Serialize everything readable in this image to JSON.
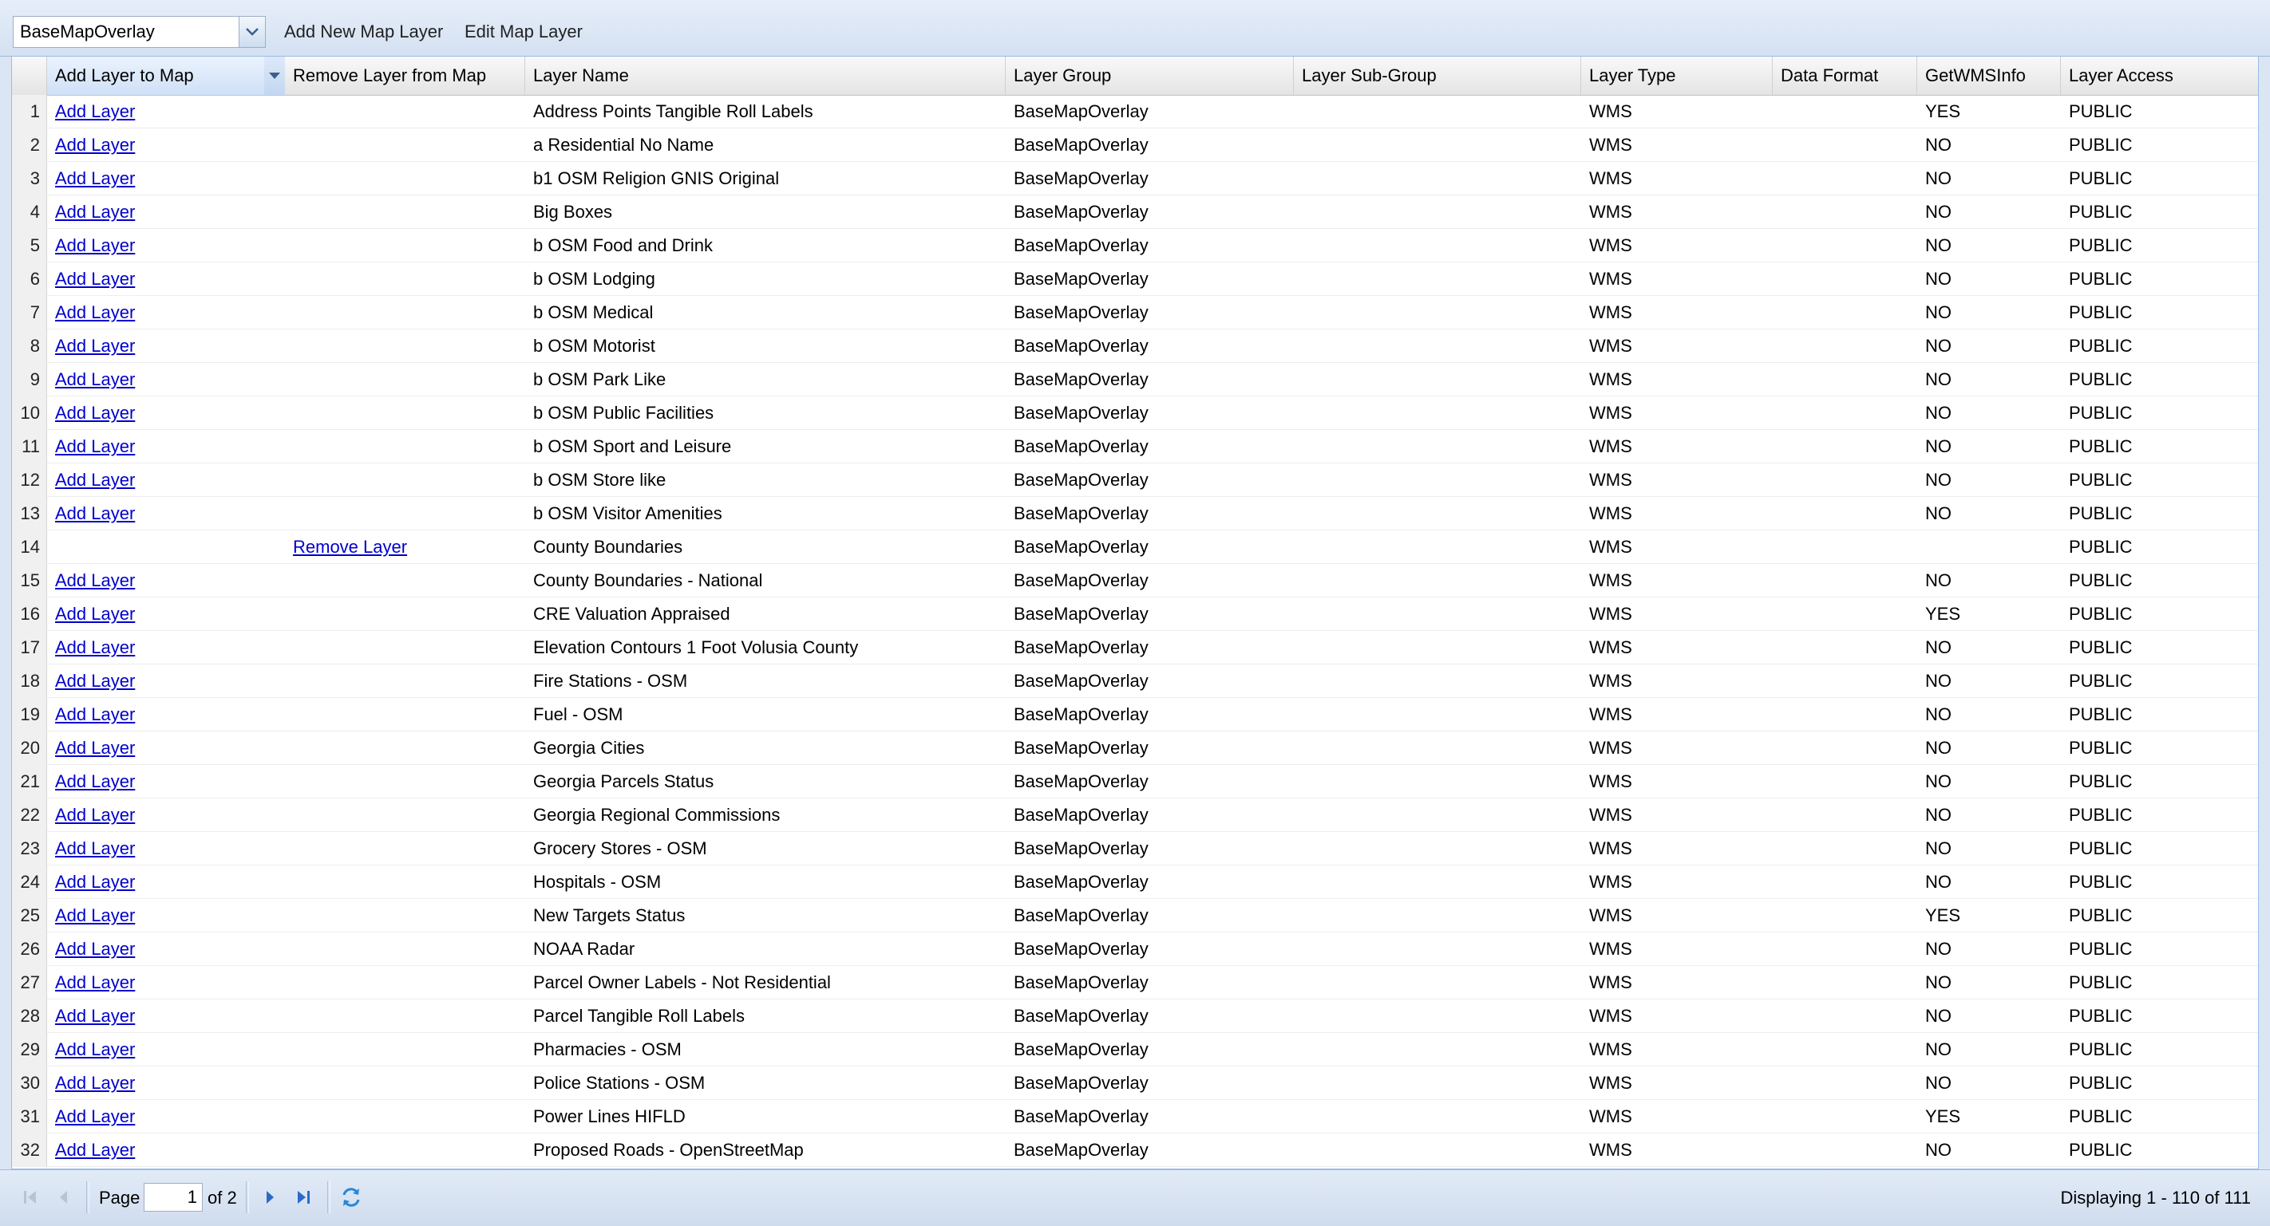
{
  "toolbar": {
    "group_select_value": "BaseMapOverlay",
    "add_new_label": "Add New Map Layer",
    "edit_label": "Edit Map Layer"
  },
  "columns": {
    "add": "Add Layer to Map",
    "remove": "Remove Layer from Map",
    "name": "Layer Name",
    "group": "Layer Group",
    "subgroup": "Layer Sub-Group",
    "type": "Layer Type",
    "format": "Data Format",
    "wms": "GetWMSInfo",
    "access": "Layer Access"
  },
  "rows": [
    {
      "n": "1",
      "add": "Add Layer",
      "remove": "",
      "name": "Address Points Tangible Roll Labels",
      "group": "BaseMapOverlay",
      "subgroup": "",
      "type": "WMS",
      "format": "",
      "wms": "YES",
      "access": "PUBLIC"
    },
    {
      "n": "2",
      "add": "Add Layer",
      "remove": "",
      "name": "a Residential No Name",
      "group": "BaseMapOverlay",
      "subgroup": "",
      "type": "WMS",
      "format": "",
      "wms": "NO",
      "access": "PUBLIC"
    },
    {
      "n": "3",
      "add": "Add Layer",
      "remove": "",
      "name": "b1 OSM Religion GNIS Original",
      "group": "BaseMapOverlay",
      "subgroup": "",
      "type": "WMS",
      "format": "",
      "wms": "NO",
      "access": "PUBLIC"
    },
    {
      "n": "4",
      "add": "Add Layer",
      "remove": "",
      "name": "Big Boxes",
      "group": "BaseMapOverlay",
      "subgroup": "",
      "type": "WMS",
      "format": "",
      "wms": "NO",
      "access": "PUBLIC"
    },
    {
      "n": "5",
      "add": "Add Layer",
      "remove": "",
      "name": "b OSM Food and Drink",
      "group": "BaseMapOverlay",
      "subgroup": "",
      "type": "WMS",
      "format": "",
      "wms": "NO",
      "access": "PUBLIC"
    },
    {
      "n": "6",
      "add": "Add Layer",
      "remove": "",
      "name": "b OSM Lodging",
      "group": "BaseMapOverlay",
      "subgroup": "",
      "type": "WMS",
      "format": "",
      "wms": "NO",
      "access": "PUBLIC"
    },
    {
      "n": "7",
      "add": "Add Layer",
      "remove": "",
      "name": "b OSM Medical",
      "group": "BaseMapOverlay",
      "subgroup": "",
      "type": "WMS",
      "format": "",
      "wms": "NO",
      "access": "PUBLIC"
    },
    {
      "n": "8",
      "add": "Add Layer",
      "remove": "",
      "name": "b OSM Motorist",
      "group": "BaseMapOverlay",
      "subgroup": "",
      "type": "WMS",
      "format": "",
      "wms": "NO",
      "access": "PUBLIC"
    },
    {
      "n": "9",
      "add": "Add Layer",
      "remove": "",
      "name": "b OSM Park Like",
      "group": "BaseMapOverlay",
      "subgroup": "",
      "type": "WMS",
      "format": "",
      "wms": "NO",
      "access": "PUBLIC"
    },
    {
      "n": "10",
      "add": "Add Layer",
      "remove": "",
      "name": "b OSM Public Facilities",
      "group": "BaseMapOverlay",
      "subgroup": "",
      "type": "WMS",
      "format": "",
      "wms": "NO",
      "access": "PUBLIC"
    },
    {
      "n": "11",
      "add": "Add Layer",
      "remove": "",
      "name": "b OSM Sport and Leisure",
      "group": "BaseMapOverlay",
      "subgroup": "",
      "type": "WMS",
      "format": "",
      "wms": "NO",
      "access": "PUBLIC"
    },
    {
      "n": "12",
      "add": "Add Layer",
      "remove": "",
      "name": "b OSM Store like",
      "group": "BaseMapOverlay",
      "subgroup": "",
      "type": "WMS",
      "format": "",
      "wms": "NO",
      "access": "PUBLIC"
    },
    {
      "n": "13",
      "add": "Add Layer",
      "remove": "",
      "name": "b OSM Visitor Amenities",
      "group": "BaseMapOverlay",
      "subgroup": "",
      "type": "WMS",
      "format": "",
      "wms": "NO",
      "access": "PUBLIC"
    },
    {
      "n": "14",
      "add": "",
      "remove": "Remove Layer",
      "name": "County Boundaries",
      "group": "BaseMapOverlay",
      "subgroup": "",
      "type": "WMS",
      "format": "",
      "wms": "",
      "access": "PUBLIC"
    },
    {
      "n": "15",
      "add": "Add Layer",
      "remove": "",
      "name": "County Boundaries - National",
      "group": "BaseMapOverlay",
      "subgroup": "",
      "type": "WMS",
      "format": "",
      "wms": "NO",
      "access": "PUBLIC"
    },
    {
      "n": "16",
      "add": "Add Layer",
      "remove": "",
      "name": "CRE Valuation Appraised",
      "group": "BaseMapOverlay",
      "subgroup": "",
      "type": "WMS",
      "format": "",
      "wms": "YES",
      "access": "PUBLIC"
    },
    {
      "n": "17",
      "add": "Add Layer",
      "remove": "",
      "name": "Elevation Contours 1 Foot Volusia County",
      "group": "BaseMapOverlay",
      "subgroup": "",
      "type": "WMS",
      "format": "",
      "wms": "NO",
      "access": "PUBLIC"
    },
    {
      "n": "18",
      "add": "Add Layer",
      "remove": "",
      "name": "Fire Stations - OSM",
      "group": "BaseMapOverlay",
      "subgroup": "",
      "type": "WMS",
      "format": "",
      "wms": "NO",
      "access": "PUBLIC"
    },
    {
      "n": "19",
      "add": "Add Layer",
      "remove": "",
      "name": "Fuel - OSM",
      "group": "BaseMapOverlay",
      "subgroup": "",
      "type": "WMS",
      "format": "",
      "wms": "NO",
      "access": "PUBLIC"
    },
    {
      "n": "20",
      "add": "Add Layer",
      "remove": "",
      "name": "Georgia Cities",
      "group": "BaseMapOverlay",
      "subgroup": "",
      "type": "WMS",
      "format": "",
      "wms": "NO",
      "access": "PUBLIC"
    },
    {
      "n": "21",
      "add": "Add Layer",
      "remove": "",
      "name": "Georgia Parcels Status",
      "group": "BaseMapOverlay",
      "subgroup": "",
      "type": "WMS",
      "format": "",
      "wms": "NO",
      "access": "PUBLIC"
    },
    {
      "n": "22",
      "add": "Add Layer",
      "remove": "",
      "name": "Georgia Regional Commissions",
      "group": "BaseMapOverlay",
      "subgroup": "",
      "type": "WMS",
      "format": "",
      "wms": "NO",
      "access": "PUBLIC"
    },
    {
      "n": "23",
      "add": "Add Layer",
      "remove": "",
      "name": "Grocery Stores - OSM",
      "group": "BaseMapOverlay",
      "subgroup": "",
      "type": "WMS",
      "format": "",
      "wms": "NO",
      "access": "PUBLIC"
    },
    {
      "n": "24",
      "add": "Add Layer",
      "remove": "",
      "name": "Hospitals - OSM",
      "group": "BaseMapOverlay",
      "subgroup": "",
      "type": "WMS",
      "format": "",
      "wms": "NO",
      "access": "PUBLIC"
    },
    {
      "n": "25",
      "add": "Add Layer",
      "remove": "",
      "name": "New Targets Status",
      "group": "BaseMapOverlay",
      "subgroup": "",
      "type": "WMS",
      "format": "",
      "wms": "YES",
      "access": "PUBLIC"
    },
    {
      "n": "26",
      "add": "Add Layer",
      "remove": "",
      "name": "NOAA Radar",
      "group": "BaseMapOverlay",
      "subgroup": "",
      "type": "WMS",
      "format": "",
      "wms": "NO",
      "access": "PUBLIC"
    },
    {
      "n": "27",
      "add": "Add Layer",
      "remove": "",
      "name": "Parcel Owner Labels - Not Residential",
      "group": "BaseMapOverlay",
      "subgroup": "",
      "type": "WMS",
      "format": "",
      "wms": "NO",
      "access": "PUBLIC"
    },
    {
      "n": "28",
      "add": "Add Layer",
      "remove": "",
      "name": "Parcel Tangible Roll Labels",
      "group": "BaseMapOverlay",
      "subgroup": "",
      "type": "WMS",
      "format": "",
      "wms": "NO",
      "access": "PUBLIC"
    },
    {
      "n": "29",
      "add": "Add Layer",
      "remove": "",
      "name": "Pharmacies - OSM",
      "group": "BaseMapOverlay",
      "subgroup": "",
      "type": "WMS",
      "format": "",
      "wms": "NO",
      "access": "PUBLIC"
    },
    {
      "n": "30",
      "add": "Add Layer",
      "remove": "",
      "name": "Police Stations - OSM",
      "group": "BaseMapOverlay",
      "subgroup": "",
      "type": "WMS",
      "format": "",
      "wms": "NO",
      "access": "PUBLIC"
    },
    {
      "n": "31",
      "add": "Add Layer",
      "remove": "",
      "name": "Power Lines HIFLD",
      "group": "BaseMapOverlay",
      "subgroup": "",
      "type": "WMS",
      "format": "",
      "wms": "YES",
      "access": "PUBLIC"
    },
    {
      "n": "32",
      "add": "Add Layer",
      "remove": "",
      "name": "Proposed Roads - OpenStreetMap",
      "group": "BaseMapOverlay",
      "subgroup": "",
      "type": "WMS",
      "format": "",
      "wms": "NO",
      "access": "PUBLIC"
    }
  ],
  "pager": {
    "page_label": "Page",
    "page_value": "1",
    "of_label": "of 2",
    "display_text": "Displaying 1 - 110 of 111"
  },
  "icons": {
    "first": "first-page-icon",
    "prev": "prev-page-icon",
    "next": "next-page-icon",
    "last": "last-page-icon",
    "refresh": "refresh-icon",
    "dropdown": "chevron-down-icon"
  },
  "colors": {
    "link": "#0000cc",
    "header_active": "#cfe0f7",
    "panel": "#dbe6f4"
  }
}
